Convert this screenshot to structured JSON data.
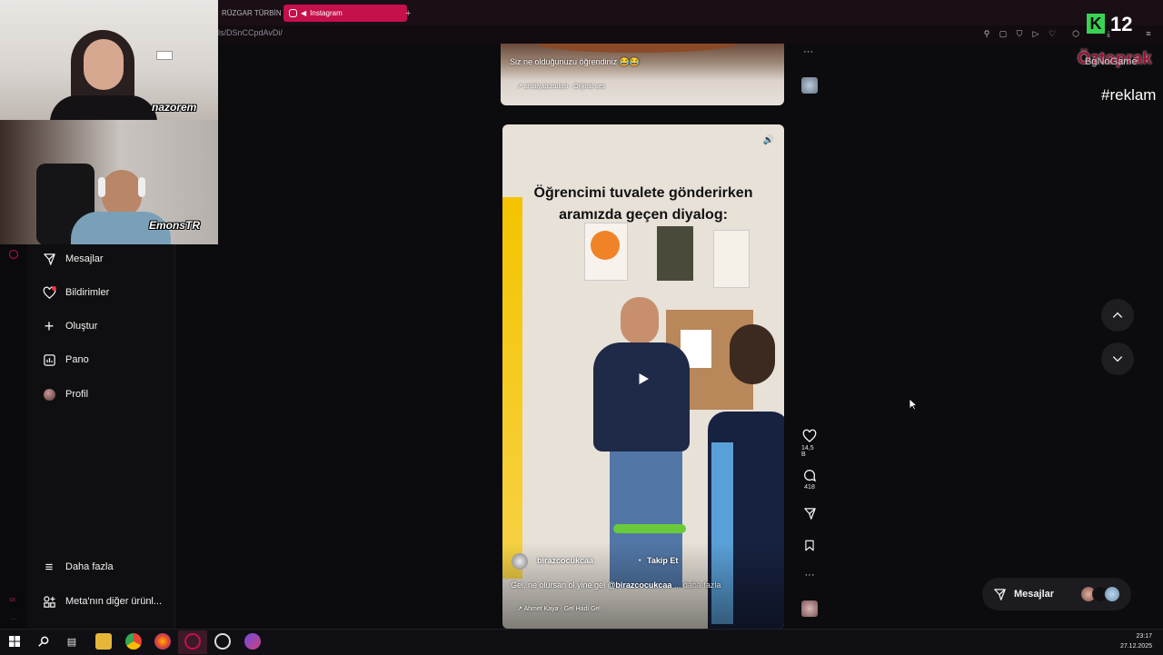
{
  "browser": {
    "tabs": [
      {
        "label": "RÜZGAR TÜRBİN"
      },
      {
        "label": "Instagram"
      }
    ],
    "new_tab": "+",
    "url": "ls/DSnCCpdAvDi/"
  },
  "overlay": {
    "counter": "12",
    "counter_logo": "K",
    "brand_top": "Öztoprak",
    "brand_sub": "BgNoGame",
    "ad_tag": "#reklam",
    "cam1_name": "nazorem",
    "cam2_name": "EmonsTR"
  },
  "sidebar": {
    "items": [
      {
        "label": "Mesajlar",
        "icon": "send-icon"
      },
      {
        "label": "Bildirimler",
        "icon": "heart-icon"
      },
      {
        "label": "Oluştur",
        "icon": "plus-icon"
      },
      {
        "label": "Pano",
        "icon": "chart-icon"
      },
      {
        "label": "Profil",
        "icon": "avatar-icon"
      }
    ],
    "more": "Daha fazla",
    "meta": "Meta'nın diğer ürünl..."
  },
  "post_top": {
    "caption": "Siz ne olduğunuzu öğrendiniz 😂😂",
    "audio": "antalyapusulasi · Orijinal ses"
  },
  "post_main": {
    "title_line1": "Öğrencimi tuvalete gönderirken",
    "title_line2": "aramızda geçen diyalog:",
    "username": "birazcocukcaa",
    "follow": "Takip Et",
    "caption_start": "Gel, ne olursan ol yine gel",
    "caption_mention": "@birazcocukcaa",
    "caption_more": "... daha fazla",
    "audio": "Ahmet Kaya · Gel Hadi Gel"
  },
  "actions": {
    "likes": "14,5 B",
    "comments": "418"
  },
  "messages_pill": {
    "label": "Mesajlar"
  },
  "taskbar": {
    "time": "23:17",
    "date": "27.12.2025"
  },
  "colors": {
    "accent": "#c5104b",
    "background": "#0c0c0e",
    "counter_green": "#39d353"
  }
}
